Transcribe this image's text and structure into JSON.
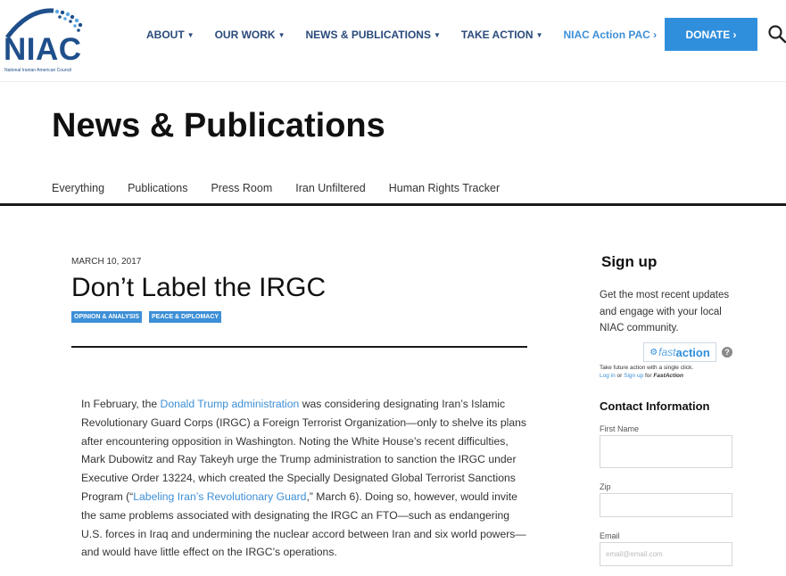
{
  "header": {
    "logo_text": "NIAC",
    "logo_subtext": "National Iranian American Council",
    "nav": [
      {
        "label": "ABOUT",
        "has_caret": true
      },
      {
        "label": "OUR WORK",
        "has_caret": true
      },
      {
        "label": "NEWS & PUBLICATIONS",
        "has_caret": true
      },
      {
        "label": "TAKE ACTION",
        "has_caret": true
      },
      {
        "label": "NIAC Action PAC ›",
        "has_caret": false
      }
    ],
    "donate_label": "DONATE ›",
    "accent_color": "#2f8fdc",
    "nav_color": "#2a4a7a"
  },
  "page": {
    "title": "News & Publications",
    "subnav": [
      "Everything",
      "Publications",
      "Press Room",
      "Iran Unfiltered",
      "Human Rights Tracker"
    ]
  },
  "article": {
    "date": "MARCH 10, 2017",
    "headline": "Don’t Label the IRGC",
    "tags": [
      "OPINION & ANALYSIS",
      "PEACE & DIPLOMACY"
    ],
    "body": {
      "p1_pre": "In February, the ",
      "link1": "Donald Trump administration",
      "p1_mid": " was considering designating Iran’s Islamic Revolutionary Guard Corps (IRGC) a Foreign Terrorist Organization—only to shelve its plans after encountering opposition in Washington. Noting the White House’s recent difficulties, Mark Dubowitz and Ray Takeyh urge the Trump administration to sanction the IRGC under Executive Order 13224, which created the Specially Designated Global Terrorist Sanctions Program (“",
      "link2": "Labeling Iran’s Revolutionary Guard",
      "p1_post": ",” March 6). Doing so, however, would invite the same problems associated with designating the IRGC an FTO—such as endangering U.S. forces in Iraq and undermining the nuclear accord between Iran and six world powers—and would have little effect on the IRGC’s operations."
    }
  },
  "sidebar": {
    "signup_title": "Sign up",
    "signup_desc": "Get the most recent updates and engage with your local NIAC community.",
    "fastaction_fast": "fast",
    "fastaction_action": "action",
    "fastaction_note_1": "Take future action with a single click.",
    "fastaction_login": "Log in",
    "fastaction_or": " or ",
    "fastaction_signup": "Sign up",
    "fastaction_for": " for ",
    "fastaction_brand": "FastAction",
    "help": "?",
    "contact_title": "Contact Information",
    "fields": {
      "first_name_label": "First Name",
      "zip_label": "Zip",
      "email_label": "Email",
      "email_placeholder": "email@email.com"
    }
  }
}
